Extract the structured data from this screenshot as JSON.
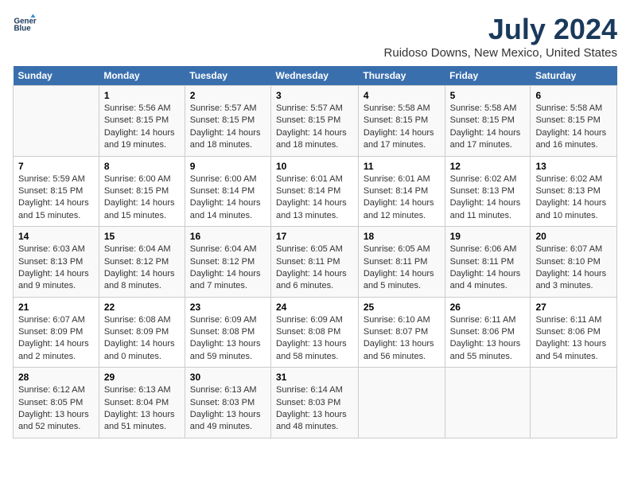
{
  "header": {
    "logo_line1": "General",
    "logo_line2": "Blue",
    "title": "July 2024",
    "subtitle": "Ruidoso Downs, New Mexico, United States"
  },
  "calendar": {
    "weekdays": [
      "Sunday",
      "Monday",
      "Tuesday",
      "Wednesday",
      "Thursday",
      "Friday",
      "Saturday"
    ],
    "weeks": [
      [
        {
          "day": "",
          "detail": ""
        },
        {
          "day": "1",
          "detail": "Sunrise: 5:56 AM\nSunset: 8:15 PM\nDaylight: 14 hours\nand 19 minutes."
        },
        {
          "day": "2",
          "detail": "Sunrise: 5:57 AM\nSunset: 8:15 PM\nDaylight: 14 hours\nand 18 minutes."
        },
        {
          "day": "3",
          "detail": "Sunrise: 5:57 AM\nSunset: 8:15 PM\nDaylight: 14 hours\nand 18 minutes."
        },
        {
          "day": "4",
          "detail": "Sunrise: 5:58 AM\nSunset: 8:15 PM\nDaylight: 14 hours\nand 17 minutes."
        },
        {
          "day": "5",
          "detail": "Sunrise: 5:58 AM\nSunset: 8:15 PM\nDaylight: 14 hours\nand 17 minutes."
        },
        {
          "day": "6",
          "detail": "Sunrise: 5:58 AM\nSunset: 8:15 PM\nDaylight: 14 hours\nand 16 minutes."
        }
      ],
      [
        {
          "day": "7",
          "detail": "Sunrise: 5:59 AM\nSunset: 8:15 PM\nDaylight: 14 hours\nand 15 minutes."
        },
        {
          "day": "8",
          "detail": "Sunrise: 6:00 AM\nSunset: 8:15 PM\nDaylight: 14 hours\nand 15 minutes."
        },
        {
          "day": "9",
          "detail": "Sunrise: 6:00 AM\nSunset: 8:14 PM\nDaylight: 14 hours\nand 14 minutes."
        },
        {
          "day": "10",
          "detail": "Sunrise: 6:01 AM\nSunset: 8:14 PM\nDaylight: 14 hours\nand 13 minutes."
        },
        {
          "day": "11",
          "detail": "Sunrise: 6:01 AM\nSunset: 8:14 PM\nDaylight: 14 hours\nand 12 minutes."
        },
        {
          "day": "12",
          "detail": "Sunrise: 6:02 AM\nSunset: 8:13 PM\nDaylight: 14 hours\nand 11 minutes."
        },
        {
          "day": "13",
          "detail": "Sunrise: 6:02 AM\nSunset: 8:13 PM\nDaylight: 14 hours\nand 10 minutes."
        }
      ],
      [
        {
          "day": "14",
          "detail": "Sunrise: 6:03 AM\nSunset: 8:13 PM\nDaylight: 14 hours\nand 9 minutes."
        },
        {
          "day": "15",
          "detail": "Sunrise: 6:04 AM\nSunset: 8:12 PM\nDaylight: 14 hours\nand 8 minutes."
        },
        {
          "day": "16",
          "detail": "Sunrise: 6:04 AM\nSunset: 8:12 PM\nDaylight: 14 hours\nand 7 minutes."
        },
        {
          "day": "17",
          "detail": "Sunrise: 6:05 AM\nSunset: 8:11 PM\nDaylight: 14 hours\nand 6 minutes."
        },
        {
          "day": "18",
          "detail": "Sunrise: 6:05 AM\nSunset: 8:11 PM\nDaylight: 14 hours\nand 5 minutes."
        },
        {
          "day": "19",
          "detail": "Sunrise: 6:06 AM\nSunset: 8:11 PM\nDaylight: 14 hours\nand 4 minutes."
        },
        {
          "day": "20",
          "detail": "Sunrise: 6:07 AM\nSunset: 8:10 PM\nDaylight: 14 hours\nand 3 minutes."
        }
      ],
      [
        {
          "day": "21",
          "detail": "Sunrise: 6:07 AM\nSunset: 8:09 PM\nDaylight: 14 hours\nand 2 minutes."
        },
        {
          "day": "22",
          "detail": "Sunrise: 6:08 AM\nSunset: 8:09 PM\nDaylight: 14 hours\nand 0 minutes."
        },
        {
          "day": "23",
          "detail": "Sunrise: 6:09 AM\nSunset: 8:08 PM\nDaylight: 13 hours\nand 59 minutes."
        },
        {
          "day": "24",
          "detail": "Sunrise: 6:09 AM\nSunset: 8:08 PM\nDaylight: 13 hours\nand 58 minutes."
        },
        {
          "day": "25",
          "detail": "Sunrise: 6:10 AM\nSunset: 8:07 PM\nDaylight: 13 hours\nand 56 minutes."
        },
        {
          "day": "26",
          "detail": "Sunrise: 6:11 AM\nSunset: 8:06 PM\nDaylight: 13 hours\nand 55 minutes."
        },
        {
          "day": "27",
          "detail": "Sunrise: 6:11 AM\nSunset: 8:06 PM\nDaylight: 13 hours\nand 54 minutes."
        }
      ],
      [
        {
          "day": "28",
          "detail": "Sunrise: 6:12 AM\nSunset: 8:05 PM\nDaylight: 13 hours\nand 52 minutes."
        },
        {
          "day": "29",
          "detail": "Sunrise: 6:13 AM\nSunset: 8:04 PM\nDaylight: 13 hours\nand 51 minutes."
        },
        {
          "day": "30",
          "detail": "Sunrise: 6:13 AM\nSunset: 8:03 PM\nDaylight: 13 hours\nand 49 minutes."
        },
        {
          "day": "31",
          "detail": "Sunrise: 6:14 AM\nSunset: 8:03 PM\nDaylight: 13 hours\nand 48 minutes."
        },
        {
          "day": "",
          "detail": ""
        },
        {
          "day": "",
          "detail": ""
        },
        {
          "day": "",
          "detail": ""
        }
      ]
    ]
  }
}
